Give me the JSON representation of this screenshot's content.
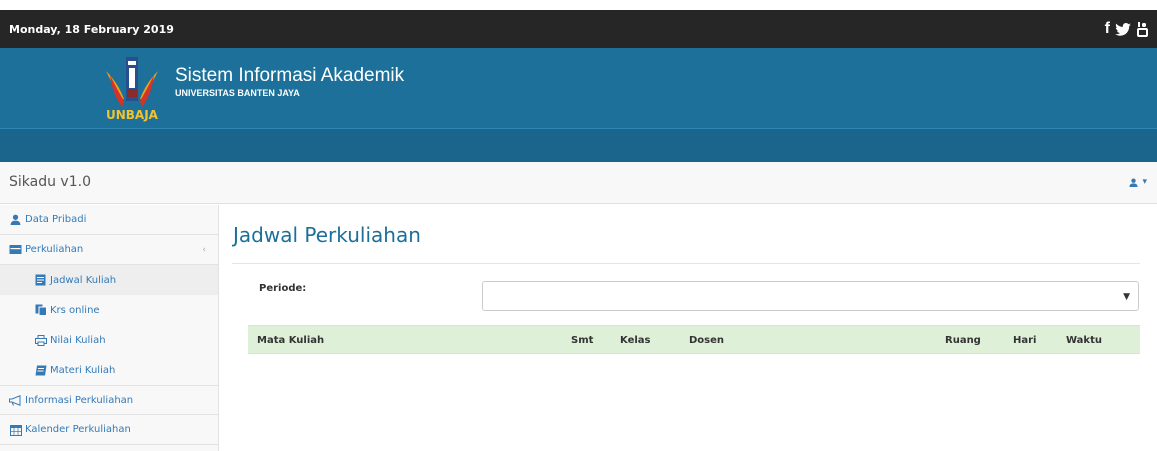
{
  "topbar": {
    "date": "Monday, 18 February 2019"
  },
  "header": {
    "title": "Sistem Informasi Akademik",
    "subtitle": "UNIVERSITAS BANTEN JAYA",
    "logo_text": "UNBAJA"
  },
  "navbar": {
    "brand": "Sikadu v1.0",
    "user_caret": "▾"
  },
  "sidebar": {
    "items": [
      {
        "label": "Data Pribadi",
        "icon": "user-icon"
      },
      {
        "label": "Perkuliahan",
        "icon": "folder-icon",
        "chevron": "‹"
      },
      {
        "label": "Jadwal Kuliah",
        "icon": "schedule-icon"
      },
      {
        "label": "Krs online",
        "icon": "copy-icon"
      },
      {
        "label": "Nilai Kuliah",
        "icon": "print-icon"
      },
      {
        "label": "Materi Kuliah",
        "icon": "book-icon"
      },
      {
        "label": "Informasi Perkuliahan",
        "icon": "megaphone-icon"
      },
      {
        "label": "Kalender Perkuliahan",
        "icon": "calendar-icon"
      }
    ]
  },
  "main": {
    "title": "Jadwal Perkuliahan",
    "periode_label": "Periode:",
    "periode_value": "",
    "select_arrow": "▼",
    "columns": [
      "Mata Kuliah",
      "Smt",
      "Kelas",
      "Dosen",
      "Ruang",
      "Hari",
      "Waktu"
    ]
  },
  "colors": {
    "topbar": "#262626",
    "banner": "#1c7099",
    "title": "#1c6f99",
    "table_header": "#dff0d8",
    "link": "#337ab7"
  }
}
